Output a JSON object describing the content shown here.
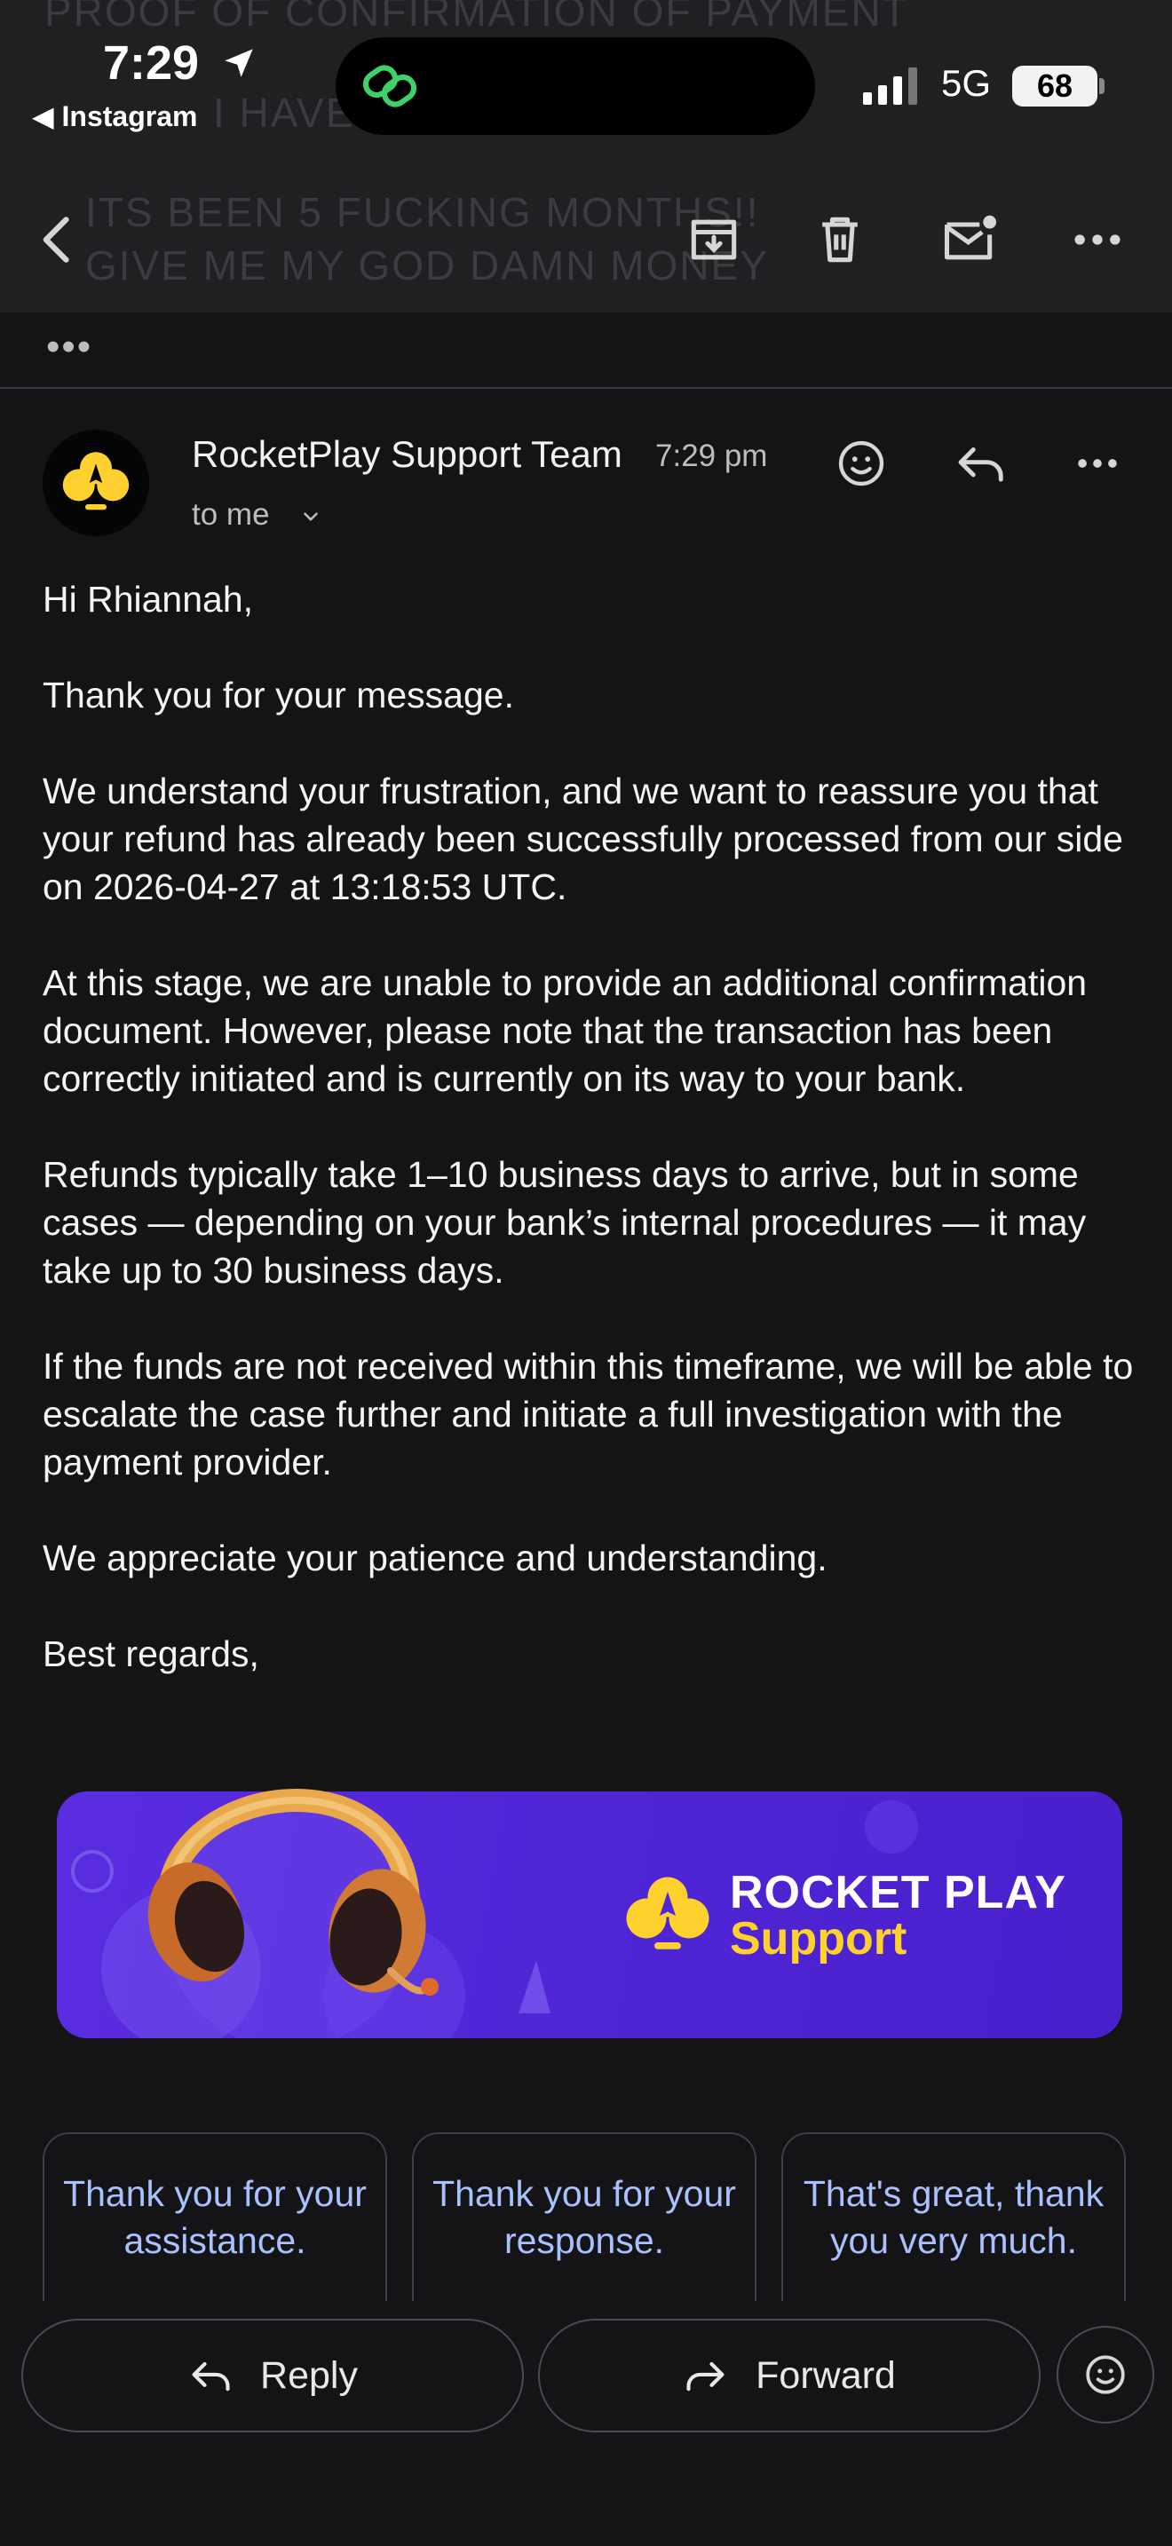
{
  "status_bar": {
    "time": "7:29",
    "back_app": "◀ Instagram",
    "network": "5G",
    "battery": "68"
  },
  "thread_ghost": {
    "line1": "PROOF OF CONFIRMATION OF PAYMENT",
    "line2": "I HAVEN",
    "line3": "ITS BEEN 5 FUCKING MONTHS!!",
    "line4": "GIVE ME MY GOD DAMN MONEY"
  },
  "toolbar": {
    "back_icon": "back-arrow-icon",
    "archive_icon": "archive-icon",
    "delete_icon": "trash-icon",
    "unread_icon": "mark-unread-icon",
    "more_icon": "more-icon"
  },
  "collapsed": {
    "dots": "•••"
  },
  "message": {
    "sender": "RocketPlay Support Team",
    "time": "7:29 pm",
    "recipient": "to me",
    "paragraphs": [
      "Hi Rhiannah,",
      "Thank you for your message.",
      "We understand your frustration, and we want to reassure you that your refund has already been successfully processed from our side on 2026-04-27 at 13:18:53 UTC.",
      "At this stage, we are unable to provide an additional confirmation document. However, please note that the transaction has been correctly initiated and is currently on its way to your bank.",
      "Refunds typically take 1–10 business days to arrive, but in some cases — depending on your bank’s internal procedures — it may take up to 30 business days.",
      "If the funds are not received within this timeframe, we will be able to escalate the case further and initiate a full investigation with the payment provider.",
      "We appreciate your patience and understanding.",
      "Best regards,"
    ],
    "banner": {
      "title": "ROCKET PLAY",
      "subtitle": "Support"
    }
  },
  "smart_replies": [
    "Thank you for your assistance.",
    "Thank you for your response.",
    "That's great, thank you very much."
  ],
  "actions": {
    "reply": "Reply",
    "forward": "Forward"
  },
  "colors": {
    "background": "#141416",
    "toolbar": "#1f2022",
    "chip_text": "#a9c2ff",
    "brand_yellow": "#ffd12f",
    "banner_purple": "#5a2de0"
  }
}
